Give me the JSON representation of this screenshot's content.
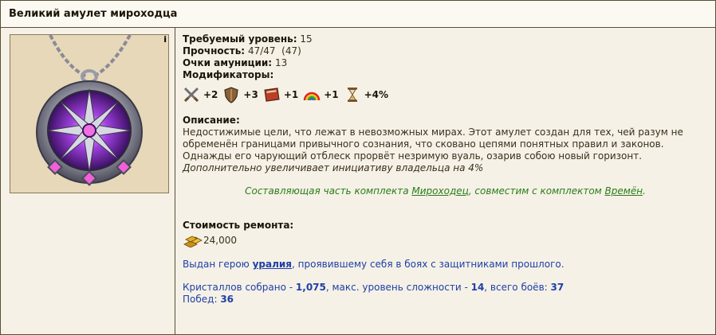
{
  "item": {
    "title": "Великий амулет мироходца",
    "info_mark": "i"
  },
  "requirements": {
    "level_label": "Требуемый уровень:",
    "level_value": "15",
    "durability_label": "Прочность:",
    "durability_value": "47/47  (47)",
    "ammo_label": "Очки амуниции:",
    "ammo_value": "13",
    "mods_label": "Модификаторы:"
  },
  "modifiers": [
    {
      "icon": "attack-icon",
      "value": "+2"
    },
    {
      "icon": "defense-icon",
      "value": "+3"
    },
    {
      "icon": "knowledge-icon",
      "value": "+1"
    },
    {
      "icon": "luck-icon",
      "value": "+1"
    },
    {
      "icon": "initiative-icon",
      "value": "+4%"
    }
  ],
  "description": {
    "label": "Описание:",
    "text": "Недостижимые цели, что лежат в невозможных мирах. Этот амулет создан для тех, чей разум не обременён границами привычного сознания, что сковано цепями понятных правил и законов. Однажды его чарующий отблеск прорвёт незримую вуаль, озарив собою новый горизонт.",
    "extra": "Дополнительно увеличивает инициативу владельца на 4%"
  },
  "set": {
    "prefix": "Составляющая часть комплекта ",
    "set_name": "Мироходец",
    "middle": ", совместим с комплектом ",
    "compat_name": "Времён",
    "suffix": "."
  },
  "repair": {
    "label": "Стоимость ремонта:",
    "cost": "24,000"
  },
  "hero": {
    "prefix": "Выдан герою ",
    "name": "уралия",
    "suffix": ", проявившему себя в боях с защитниками прошлого."
  },
  "stats": {
    "crystals_label": "Кристаллов собрано - ",
    "crystals_value": "1,075",
    "difficulty_label": ", макс. уровень сложности - ",
    "difficulty_value": "14",
    "battles_label": ", всего боёв: ",
    "battles_value": "37",
    "wins_label": "Побед: ",
    "wins_value": "36"
  },
  "colors": {
    "border": "#5a4d35",
    "panel_bg": "#f5f1e6",
    "set_green": "#2a7d19",
    "hero_blue": "#1e3fa8"
  }
}
